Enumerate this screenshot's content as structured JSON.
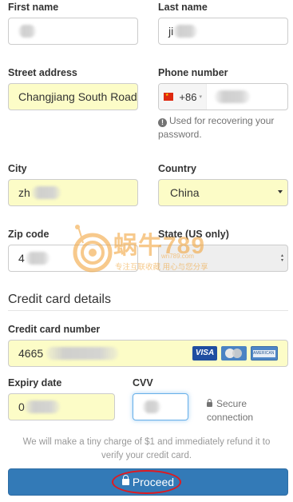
{
  "form": {
    "first_name": {
      "label": "First name",
      "value": ""
    },
    "last_name": {
      "label": "Last name",
      "value": "ji"
    },
    "street_address": {
      "label": "Street address",
      "value": "Changjiang South Road"
    },
    "phone_number": {
      "label": "Phone number",
      "country_flag": "cn-flag-icon",
      "dial_code": "+86",
      "value": "",
      "help_text": "Used for recovering your password."
    },
    "city": {
      "label": "City",
      "value": "zh"
    },
    "country": {
      "label": "Country",
      "value": "China"
    },
    "zip_code": {
      "label": "Zip code",
      "value": "4"
    },
    "state": {
      "label": "State (US only)",
      "value": ""
    }
  },
  "credit_card": {
    "section_title": "Credit card details",
    "number": {
      "label": "Credit card number",
      "value": "4665",
      "brands": [
        "VISA",
        "MasterCard",
        "American Express"
      ]
    },
    "expiry": {
      "label": "Expiry date",
      "value": "0"
    },
    "cvv": {
      "label": "CVV",
      "value": ""
    },
    "secure_text": "Secure connection"
  },
  "note": "We will make a tiny charge of $1 and immediately refund it to verify your credit card.",
  "proceed_label": "Proceed",
  "watermark": {
    "text": "蜗牛789",
    "url": "wn789.com",
    "tagline": "专注互联收藏  用心与您分享"
  },
  "colors": {
    "autofill": "#fcfcc7",
    "primary": "#337ab7",
    "highlight": "#e0191f"
  }
}
